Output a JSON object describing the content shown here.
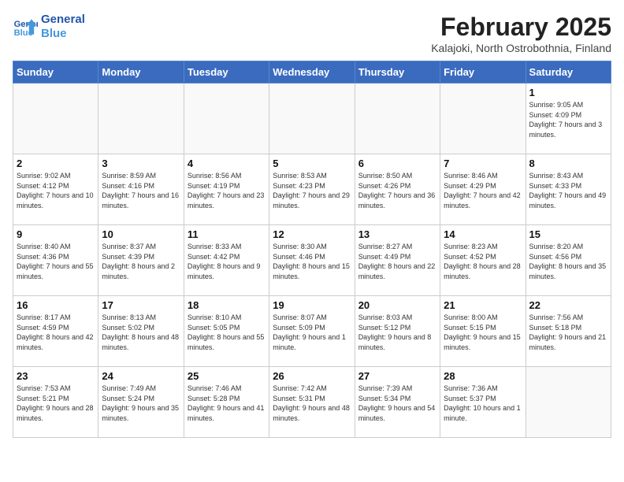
{
  "logo": {
    "line1": "General",
    "line2": "Blue"
  },
  "title": "February 2025",
  "location": "Kalajoki, North Ostrobothnia, Finland",
  "weekdays": [
    "Sunday",
    "Monday",
    "Tuesday",
    "Wednesday",
    "Thursday",
    "Friday",
    "Saturday"
  ],
  "weeks": [
    [
      {
        "day": "",
        "info": ""
      },
      {
        "day": "",
        "info": ""
      },
      {
        "day": "",
        "info": ""
      },
      {
        "day": "",
        "info": ""
      },
      {
        "day": "",
        "info": ""
      },
      {
        "day": "",
        "info": ""
      },
      {
        "day": "1",
        "info": "Sunrise: 9:05 AM\nSunset: 4:09 PM\nDaylight: 7 hours and 3 minutes."
      }
    ],
    [
      {
        "day": "2",
        "info": "Sunrise: 9:02 AM\nSunset: 4:12 PM\nDaylight: 7 hours and 10 minutes."
      },
      {
        "day": "3",
        "info": "Sunrise: 8:59 AM\nSunset: 4:16 PM\nDaylight: 7 hours and 16 minutes."
      },
      {
        "day": "4",
        "info": "Sunrise: 8:56 AM\nSunset: 4:19 PM\nDaylight: 7 hours and 23 minutes."
      },
      {
        "day": "5",
        "info": "Sunrise: 8:53 AM\nSunset: 4:23 PM\nDaylight: 7 hours and 29 minutes."
      },
      {
        "day": "6",
        "info": "Sunrise: 8:50 AM\nSunset: 4:26 PM\nDaylight: 7 hours and 36 minutes."
      },
      {
        "day": "7",
        "info": "Sunrise: 8:46 AM\nSunset: 4:29 PM\nDaylight: 7 hours and 42 minutes."
      },
      {
        "day": "8",
        "info": "Sunrise: 8:43 AM\nSunset: 4:33 PM\nDaylight: 7 hours and 49 minutes."
      }
    ],
    [
      {
        "day": "9",
        "info": "Sunrise: 8:40 AM\nSunset: 4:36 PM\nDaylight: 7 hours and 55 minutes."
      },
      {
        "day": "10",
        "info": "Sunrise: 8:37 AM\nSunset: 4:39 PM\nDaylight: 8 hours and 2 minutes."
      },
      {
        "day": "11",
        "info": "Sunrise: 8:33 AM\nSunset: 4:42 PM\nDaylight: 8 hours and 9 minutes."
      },
      {
        "day": "12",
        "info": "Sunrise: 8:30 AM\nSunset: 4:46 PM\nDaylight: 8 hours and 15 minutes."
      },
      {
        "day": "13",
        "info": "Sunrise: 8:27 AM\nSunset: 4:49 PM\nDaylight: 8 hours and 22 minutes."
      },
      {
        "day": "14",
        "info": "Sunrise: 8:23 AM\nSunset: 4:52 PM\nDaylight: 8 hours and 28 minutes."
      },
      {
        "day": "15",
        "info": "Sunrise: 8:20 AM\nSunset: 4:56 PM\nDaylight: 8 hours and 35 minutes."
      }
    ],
    [
      {
        "day": "16",
        "info": "Sunrise: 8:17 AM\nSunset: 4:59 PM\nDaylight: 8 hours and 42 minutes."
      },
      {
        "day": "17",
        "info": "Sunrise: 8:13 AM\nSunset: 5:02 PM\nDaylight: 8 hours and 48 minutes."
      },
      {
        "day": "18",
        "info": "Sunrise: 8:10 AM\nSunset: 5:05 PM\nDaylight: 8 hours and 55 minutes."
      },
      {
        "day": "19",
        "info": "Sunrise: 8:07 AM\nSunset: 5:09 PM\nDaylight: 9 hours and 1 minute."
      },
      {
        "day": "20",
        "info": "Sunrise: 8:03 AM\nSunset: 5:12 PM\nDaylight: 9 hours and 8 minutes."
      },
      {
        "day": "21",
        "info": "Sunrise: 8:00 AM\nSunset: 5:15 PM\nDaylight: 9 hours and 15 minutes."
      },
      {
        "day": "22",
        "info": "Sunrise: 7:56 AM\nSunset: 5:18 PM\nDaylight: 9 hours and 21 minutes."
      }
    ],
    [
      {
        "day": "23",
        "info": "Sunrise: 7:53 AM\nSunset: 5:21 PM\nDaylight: 9 hours and 28 minutes."
      },
      {
        "day": "24",
        "info": "Sunrise: 7:49 AM\nSunset: 5:24 PM\nDaylight: 9 hours and 35 minutes."
      },
      {
        "day": "25",
        "info": "Sunrise: 7:46 AM\nSunset: 5:28 PM\nDaylight: 9 hours and 41 minutes."
      },
      {
        "day": "26",
        "info": "Sunrise: 7:42 AM\nSunset: 5:31 PM\nDaylight: 9 hours and 48 minutes."
      },
      {
        "day": "27",
        "info": "Sunrise: 7:39 AM\nSunset: 5:34 PM\nDaylight: 9 hours and 54 minutes."
      },
      {
        "day": "28",
        "info": "Sunrise: 7:36 AM\nSunset: 5:37 PM\nDaylight: 10 hours and 1 minute."
      },
      {
        "day": "",
        "info": ""
      }
    ]
  ]
}
